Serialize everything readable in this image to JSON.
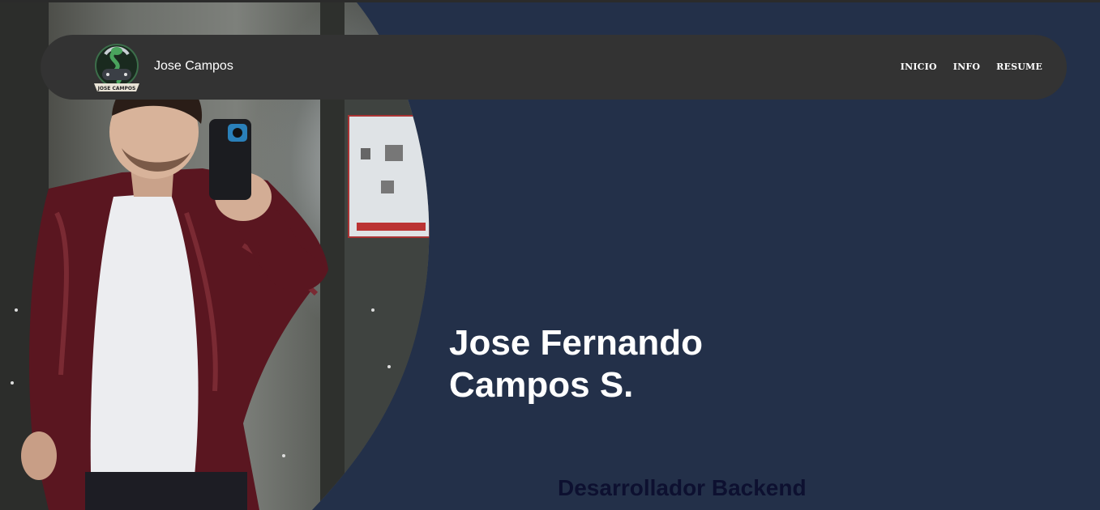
{
  "header": {
    "brand_name": "Jose Campos",
    "logo_icon": "cobra-gamepad-logo-icon",
    "logo_text": "JOSE CAMPOS",
    "nav": [
      {
        "label": "INICIO"
      },
      {
        "label": "INFO"
      },
      {
        "label": "RESUME"
      }
    ]
  },
  "hero": {
    "name_line1": "Jose Fernando",
    "name_line2": "Campos S.",
    "role": "Desarrollador Backend",
    "photo_icon": "profile-photo-mirror-selfie"
  },
  "colors": {
    "background": "#233049",
    "navbar": "#333333",
    "text": "#ffffff",
    "role_text": "#0d1030"
  }
}
